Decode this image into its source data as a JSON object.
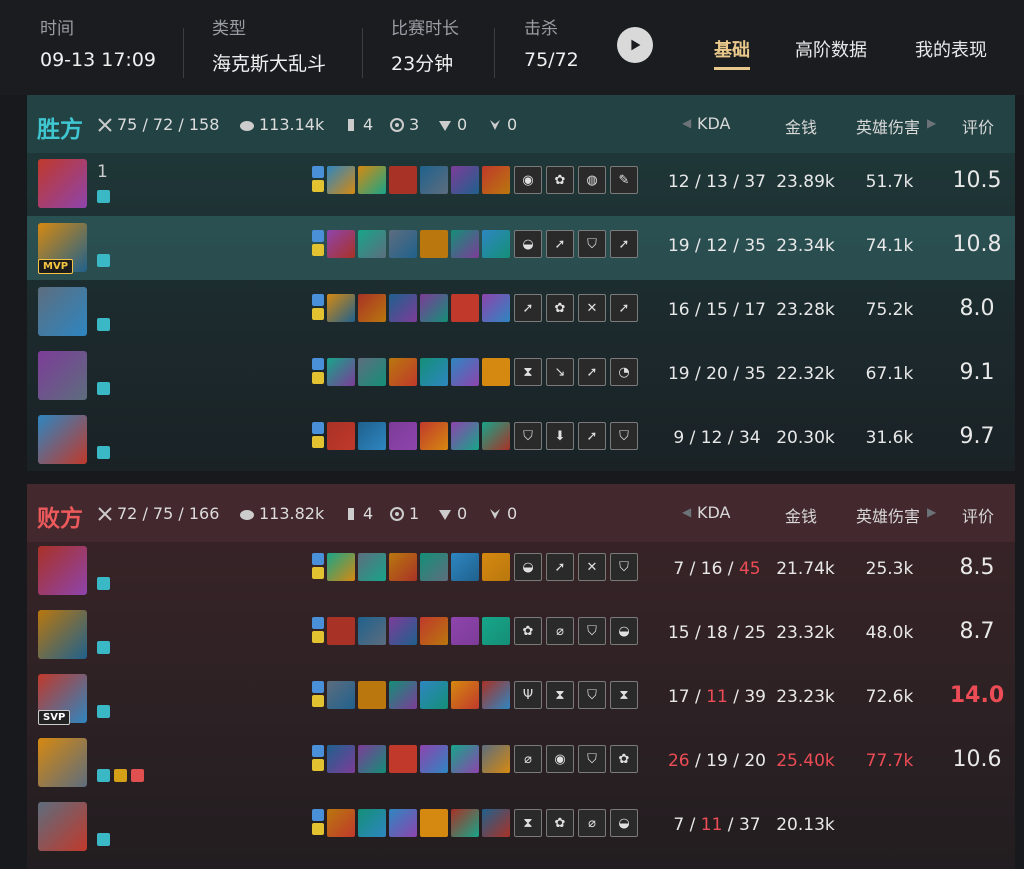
{
  "header": {
    "time_label": "时间",
    "time_value": "09-13 17:09",
    "type_label": "类型",
    "type_value": "海克斯大乱斗",
    "duration_label": "比赛时长",
    "duration_value": "23分钟",
    "kills_label": "击杀",
    "kills_value": "75/72",
    "tabs": [
      "基础",
      "高阶数据",
      "我的表现"
    ],
    "active_tab": "基础"
  },
  "columns": {
    "kda": "KDA",
    "gold": "金钱",
    "damage": "英雄伤害",
    "rating": "评价"
  },
  "win_team": {
    "name": "胜方",
    "kda": "75 / 72 / 158",
    "gold": "113.14k",
    "towers": "4",
    "inhibitors": "3",
    "barons": "0",
    "dragons": "0",
    "accent": "#3fc6d0",
    "players": [
      {
        "name": "1",
        "kda_k": "12",
        "kda_d": "13",
        "kda_a": "37",
        "gold": "23.89k",
        "damage": "51.7k",
        "rating": "10.5",
        "badge": "",
        "augs": [
          "◉",
          "✿",
          "◍",
          "✎"
        ]
      },
      {
        "name": "",
        "kda_k": "19",
        "kda_d": "12",
        "kda_a": "35",
        "gold": "23.34k",
        "damage": "74.1k",
        "rating": "10.8",
        "badge": "MVP",
        "augs": [
          "◒",
          "➚",
          "⛉",
          "➚"
        ]
      },
      {
        "name": "",
        "kda_k": "16",
        "kda_d": "15",
        "kda_a": "17",
        "gold": "23.28k",
        "damage": "75.2k",
        "rating": "8.0",
        "badge": "",
        "augs": [
          "➚",
          "✿",
          "✕",
          "➚"
        ]
      },
      {
        "name": "",
        "kda_k": "19",
        "kda_d": "20",
        "kda_a": "35",
        "gold": "22.32k",
        "damage": "67.1k",
        "rating": "9.1",
        "badge": "",
        "augs": [
          "⧗",
          "↘",
          "➚",
          "◔"
        ]
      },
      {
        "name": "",
        "kda_k": "9",
        "kda_d": "12",
        "kda_a": "34",
        "gold": "20.30k",
        "damage": "31.6k",
        "rating": "9.7",
        "badge": "",
        "augs": [
          "⛉",
          "⬇",
          "➚",
          "⛉"
        ]
      }
    ]
  },
  "lose_team": {
    "name": "败方",
    "kda": "72 / 75 / 166",
    "gold": "113.82k",
    "towers": "4",
    "inhibitors": "1",
    "barons": "0",
    "dragons": "0",
    "accent": "#ec5a5c",
    "players": [
      {
        "name": "",
        "kda_k": "7",
        "kda_d": "16",
        "kda_a": "45",
        "gold": "21.74k",
        "damage": "25.3k",
        "rating": "8.5",
        "badge": "",
        "augs": [
          "◒",
          "➚",
          "✕",
          "⛉"
        ]
      },
      {
        "name": "",
        "kda_k": "15",
        "kda_d": "18",
        "kda_a": "25",
        "gold": "23.32k",
        "damage": "48.0k",
        "rating": "8.7",
        "badge": "",
        "augs": [
          "✿",
          "⌀",
          "⛉",
          "◒"
        ]
      },
      {
        "name": "",
        "kda_k": "17",
        "kda_d": "11",
        "kda_a": "39",
        "gold": "23.23k",
        "damage": "72.6k",
        "rating": "14.0",
        "badge": "SVP",
        "augs": [
          "Ψ",
          "⧗",
          "⛉",
          "⧗"
        ]
      },
      {
        "name": "",
        "kda_k": "26",
        "kda_d": "19",
        "kda_a": "20",
        "gold": "25.40k",
        "damage": "77.7k",
        "rating": "10.6",
        "badge": "",
        "augs": [
          "⌀",
          "◉",
          "⛉",
          "✿"
        ]
      },
      {
        "name": "",
        "kda_k": "7",
        "kda_d": "11",
        "kda_a": "37",
        "gold": "20.13k",
        "damage": "",
        "rating": "",
        "badge": "",
        "augs": [
          "⧗",
          "✿",
          "⌀",
          "◒"
        ]
      }
    ]
  },
  "highlight_color": "#ec4c55"
}
